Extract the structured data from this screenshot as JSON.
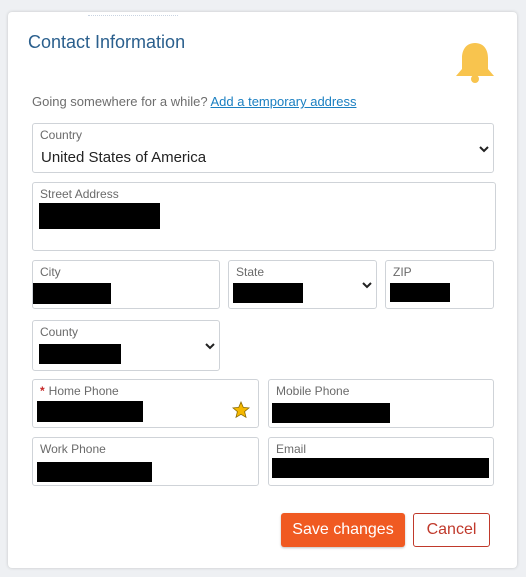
{
  "header": {
    "title": "Contact Information",
    "icon": "bell-icon",
    "icon_color": "#f8c44e"
  },
  "notice": {
    "text": "Going somewhere for a while?",
    "link": "Add a temporary address"
  },
  "fields": {
    "country": {
      "label": "Country",
      "value": "United States of America"
    },
    "street": {
      "label": "Street Address"
    },
    "city": {
      "label": "City"
    },
    "state": {
      "label": "State"
    },
    "zip": {
      "label": "ZIP"
    },
    "county": {
      "label": "County"
    },
    "home_phone": {
      "label": "Home Phone",
      "required_marker": "*",
      "primary_icon": "star-icon"
    },
    "mobile_phone": {
      "label": "Mobile Phone"
    },
    "work_phone": {
      "label": "Work Phone"
    },
    "email": {
      "label": "Email"
    }
  },
  "actions": {
    "save": "Save changes",
    "cancel": "Cancel"
  },
  "colors": {
    "title": "#2a5f8d",
    "link": "#1a7fc1",
    "save_bg": "#f05a22",
    "cancel_border": "#c0392b",
    "star": "#f5b800"
  }
}
